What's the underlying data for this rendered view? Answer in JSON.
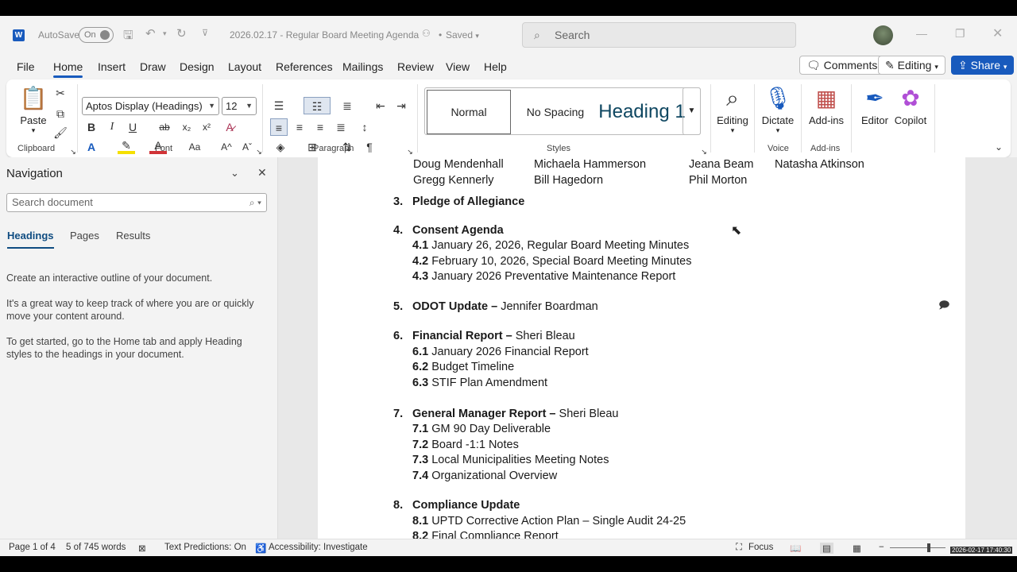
{
  "app": {
    "logo": "W",
    "autosave_label": "AutoSave",
    "autosave_state": "On",
    "doc_title": "2026.02.17 - Regular Board Meeting Agenda",
    "saved": "Saved",
    "search_placeholder": "Search"
  },
  "tabs": [
    "File",
    "Home",
    "Insert",
    "Draw",
    "Design",
    "Layout",
    "References",
    "Mailings",
    "Review",
    "View",
    "Help"
  ],
  "header_buttons": {
    "comments": "Comments",
    "editing": "Editing",
    "share": "Share"
  },
  "ribbon": {
    "clipboard": {
      "paste": "Paste",
      "label": "Clipboard"
    },
    "font": {
      "name": "Aptos Display (Headings)",
      "size": "12",
      "label": "Font",
      "bold": "B",
      "italic": "I",
      "underline": "U",
      "strike": "ab",
      "sub": "x₂",
      "sup": "x²",
      "case": "Aa",
      "grow": "A^",
      "shrink": "Aˇ"
    },
    "paragraph": {
      "label": "Paragraph"
    },
    "styles": {
      "normal": "Normal",
      "nospacing": "No Spacing",
      "heading": "Heading 1",
      "label": "Styles"
    },
    "editing": {
      "label": "Editing"
    },
    "voice": {
      "dictate": "Dictate",
      "label": "Voice"
    },
    "addins": {
      "addins": "Add-ins",
      "label": "Add-ins"
    },
    "editor": "Editor",
    "copilot": "Copilot"
  },
  "nav": {
    "title": "Navigation",
    "search_placeholder": "Search document",
    "tabs": [
      "Headings",
      "Pages",
      "Results"
    ],
    "p1": "Create an interactive outline of your document.",
    "p2": "It's a great way to keep track of where you are or quickly move your content around.",
    "p3": "To get started, go to the Home tab and apply Heading styles to the headings in your document."
  },
  "doc": {
    "names": [
      "Doug Mendenhall",
      "Michaela Hammerson",
      "Jeana Beam",
      "Natasha Atkinson",
      "Gregg Kennerly",
      "Bill Hagedorn",
      "Phil Morton"
    ],
    "items": [
      {
        "n": "3.",
        "title": "Pledge of Allegiance",
        "rest": ""
      },
      {
        "n": "4.",
        "title": "Consent Agenda",
        "rest": ""
      },
      {
        "n": "5.",
        "title": "ODOT Update – ",
        "rest": "Jennifer Boardman"
      },
      {
        "n": "6.",
        "title": "Financial Report – ",
        "rest": "Sheri Bleau"
      },
      {
        "n": "7.",
        "title": "General Manager Report – ",
        "rest": "Sheri Bleau"
      },
      {
        "n": "8.",
        "title": "Compliance Update",
        "rest": ""
      }
    ],
    "sub4": [
      [
        "4.1",
        "January 26, 2026, Regular Board Meeting Minutes"
      ],
      [
        "4.2",
        "February 10, 2026, Special Board Meeting Minutes"
      ],
      [
        "4.3",
        "January 2026 Preventative Maintenance Report"
      ]
    ],
    "sub6": [
      [
        "6.1",
        "January 2026 Financial Report"
      ],
      [
        "6.2",
        "Budget Timeline"
      ],
      [
        "6.3",
        "STIF Plan Amendment"
      ]
    ],
    "sub7": [
      [
        "7.1",
        "GM 90 Day Deliverable"
      ],
      [
        "7.2",
        "Board -1:1 Notes"
      ],
      [
        "7.3",
        "Local Municipalities Meeting Notes"
      ],
      [
        "7.4",
        "Organizational Overview"
      ]
    ],
    "sub8": [
      [
        "8.1",
        "UPTD Corrective Action Plan – Single Audit 24-25"
      ],
      [
        "8.2",
        "Final Compliance Report"
      ]
    ]
  },
  "status": {
    "page": "Page 1 of 4",
    "words": "5 of 745 words",
    "predictions": "Text Predictions: On",
    "accessibility": "Accessibility: Investigate",
    "focus": "Focus",
    "timestamp": "2026-02-17 17:40:30"
  },
  "colors": {
    "accent": "#185abd"
  }
}
